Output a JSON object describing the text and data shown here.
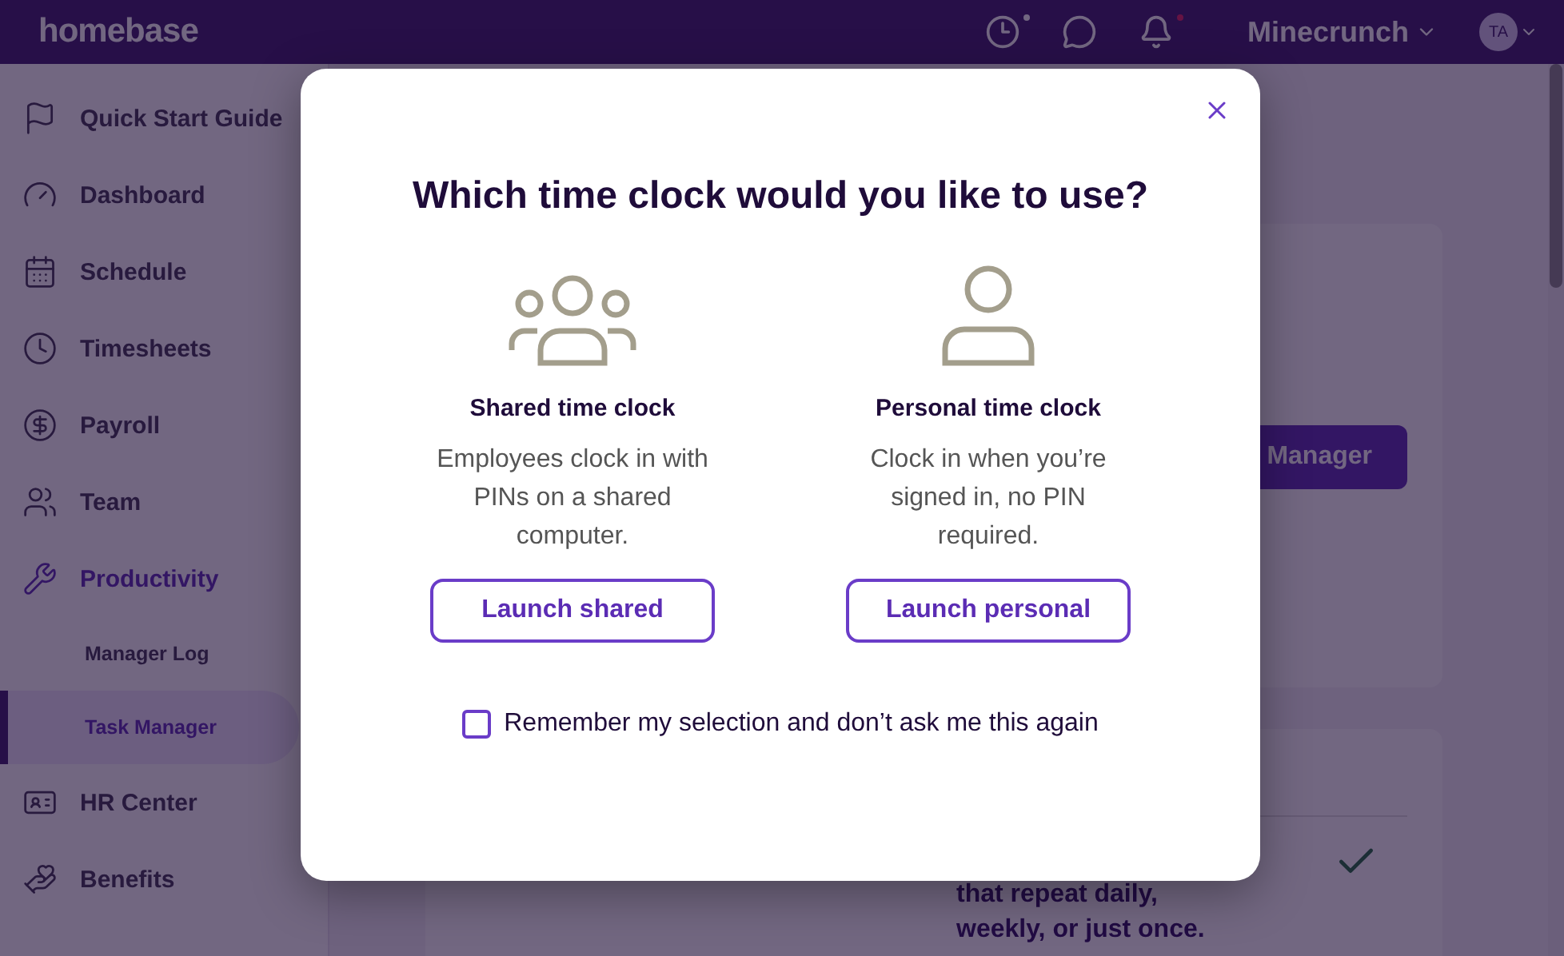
{
  "top_bar": {
    "logo": "homebase",
    "account": "Minecrunch",
    "avatar": "TA"
  },
  "sidebar": {
    "items": [
      {
        "label": "Quick Start Guide",
        "selected": false
      },
      {
        "label": "Dashboard",
        "selected": false
      },
      {
        "label": "Schedule",
        "selected": false
      },
      {
        "label": "Timesheets",
        "selected": false
      },
      {
        "label": "Payroll",
        "selected": false
      },
      {
        "label": "Team",
        "selected": false
      },
      {
        "label": "Productivity",
        "selected": true,
        "children": [
          {
            "label": "Manager Log",
            "selected": false
          },
          {
            "label": "Task Manager",
            "selected": true
          }
        ]
      },
      {
        "label": "HR Center",
        "selected": false
      },
      {
        "label": "Benefits",
        "selected": false
      }
    ]
  },
  "content": {
    "cards": [
      {
        "button": "Manager"
      },
      {
        "text": "that repeat daily, weekly, or just once."
      }
    ]
  },
  "dialog": {
    "title": "Which time clock would you like to use?",
    "options": [
      {
        "kind": "shared",
        "title": "Shared time clock",
        "description": "Employees clock in with PINs on a shared computer.",
        "button": "Launch shared"
      },
      {
        "kind": "personal",
        "title": "Personal time clock",
        "description": "Clock in when you’re signed in, no PIN required.",
        "button": "Launch personal"
      }
    ],
    "remember": {
      "label": "Remember my selection and don’t ask me this again",
      "checked": false
    }
  }
}
